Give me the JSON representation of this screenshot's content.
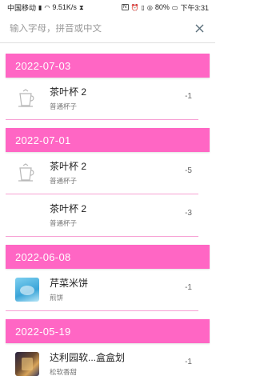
{
  "status_bar": {
    "carrier": "中国移动",
    "speed": "9.51K/s",
    "battery": "80%",
    "time": "下午3:31"
  },
  "search": {
    "placeholder": "输入字母，拼音或中文"
  },
  "groups": [
    {
      "date": "2022-07-03",
      "items": [
        {
          "title": "茶叶杯 2",
          "subtitle": "普通杯子",
          "qty": "-1",
          "icon": "cup-outline-icon"
        }
      ]
    },
    {
      "date": "2022-07-01",
      "items": [
        {
          "title": "茶叶杯 2",
          "subtitle": "普通杯子",
          "qty": "-5",
          "icon": "cup-outline-icon"
        },
        {
          "title": "茶叶杯 2",
          "subtitle": "普通杯子",
          "qty": "-3",
          "icon": "none"
        }
      ]
    },
    {
      "date": "2022-06-08",
      "items": [
        {
          "title": "芹菜米饼",
          "subtitle": "煎饼",
          "qty": "-1",
          "icon": "food-photo-blue"
        }
      ]
    },
    {
      "date": "2022-05-19",
      "items": [
        {
          "title": "达利园软...盒盒划",
          "subtitle": "松软香甜",
          "qty": "-1",
          "icon": "food-photo-dark"
        }
      ]
    }
  ],
  "colors": {
    "header_pink": "#ff66c4",
    "divider_pink": "#f7a2d4"
  }
}
